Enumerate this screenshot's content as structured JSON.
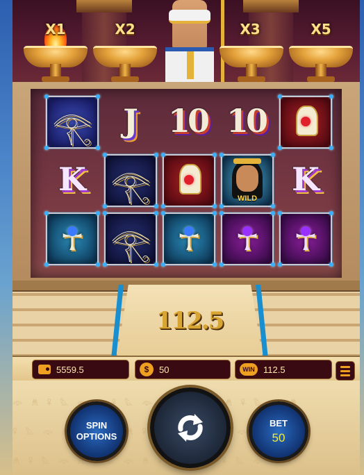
{
  "multipliers": [
    "X1",
    "X2",
    "X3",
    "X5"
  ],
  "reels": {
    "rows": [
      [
        {
          "symbol": "eye-of-horus",
          "style": "blue"
        },
        {
          "symbol": "J",
          "style": "plain"
        },
        {
          "symbol": "10",
          "style": "plain"
        },
        {
          "symbol": "10",
          "style": "plain"
        },
        {
          "symbol": "red-gem-amulet",
          "style": "red"
        }
      ],
      [
        {
          "symbol": "K",
          "style": "plain"
        },
        {
          "symbol": "eye-of-horus",
          "style": "navy"
        },
        {
          "symbol": "red-gem-amulet",
          "style": "red"
        },
        {
          "symbol": "cleopatra-wild",
          "style": "portrait",
          "label": "WILD"
        },
        {
          "symbol": "K",
          "style": "plain"
        }
      ],
      [
        {
          "symbol": "ankh",
          "style": "teal"
        },
        {
          "symbol": "eye-of-horus",
          "style": "navy"
        },
        {
          "symbol": "ankh",
          "style": "teal"
        },
        {
          "symbol": "ankh",
          "style": "purple"
        },
        {
          "symbol": "ankh",
          "style": "purple"
        }
      ]
    ]
  },
  "win_display": "112.5",
  "status": {
    "balance": "5559.5",
    "bet": "50",
    "win": "112.5",
    "coin_icon": "$",
    "win_icon": "WIN"
  },
  "controls": {
    "spin_options_label": "SPIN OPTIONS",
    "bet_label": "BET",
    "bet_value": "50"
  },
  "colors": {
    "accent_gold": "#f0a020",
    "bet_value_yellow": "#f2ec3a",
    "button_blue": "#2a6ac0",
    "rail_blue": "#1a8fd0"
  },
  "icons": {
    "spin": "refresh-arrows-icon",
    "menu": "hamburger-menu-icon",
    "balance": "wallet-icon",
    "bet": "coin-icon",
    "win": "win-badge-icon"
  }
}
